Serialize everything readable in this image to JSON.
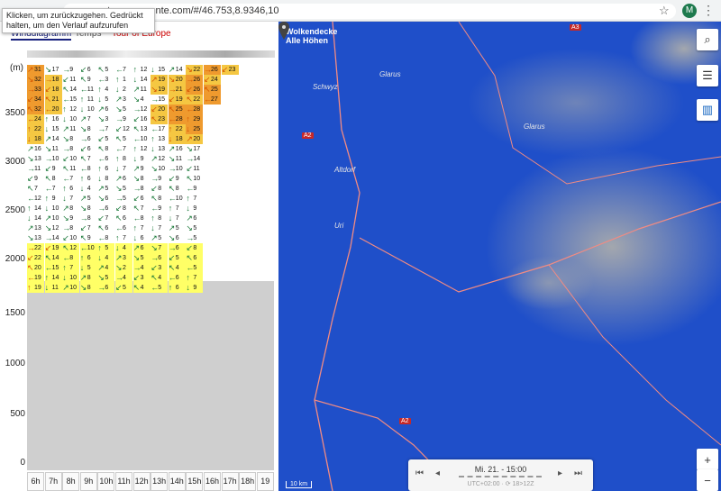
{
  "browser": {
    "url": "meteo-parapente.com/#/46.753,8.9346,10",
    "tooltip": "Klicken, um zurückzugehen. Gedrückt halten, um den Verlauf aufzurufen",
    "avatar": "M"
  },
  "tabs": [
    "Winddiagramm",
    "Temps",
    "Tour of Europe"
  ],
  "diagram": {
    "unit": "(m)",
    "y_labels": [
      "3500",
      "3000",
      "2500",
      "2000",
      "1500",
      "1000",
      "500",
      "0"
    ],
    "hours": [
      "6h",
      "7h",
      "8h",
      "9h",
      "10h",
      "11h",
      "12h",
      "13h",
      "14h",
      "15h",
      "16h",
      "17h",
      "18h",
      "19"
    ],
    "colors": {
      "calm": "#ffffff",
      "light": "#ffff66",
      "medium": "#f5c742",
      "strong": "#ef9a2e",
      "nodata": "#cfcfcf"
    },
    "rows": [
      [
        "31",
        "17",
        "9",
        "6",
        "5",
        "7",
        "12",
        "15",
        "14",
        "22",
        "26",
        "23"
      ],
      [
        "32",
        "18",
        "11",
        "9",
        "3",
        "1",
        "14",
        "19",
        "20",
        "26",
        "24"
      ],
      [
        "33",
        "18",
        "14",
        "11",
        "4",
        "2",
        "11",
        "19",
        "21",
        "26",
        "25"
      ],
      [
        "34",
        "21",
        "15",
        "11",
        "5",
        "3",
        "4",
        "15",
        "19",
        "22",
        "27"
      ],
      [
        "32",
        "20",
        "12",
        "10",
        "6",
        "5",
        "12",
        "20",
        "25",
        "28"
      ],
      [
        "24",
        "16",
        "10",
        "7",
        "3",
        "9",
        "16",
        "23",
        "28",
        "29"
      ],
      [
        "22",
        "15",
        "11",
        "8",
        "7",
        "12",
        "13",
        "17",
        "22",
        "25"
      ],
      [
        "18",
        "14",
        "8",
        "6",
        "5",
        "5",
        "10",
        "13",
        "18",
        "20"
      ],
      [
        "16",
        "11",
        "8",
        "6",
        "8",
        "7",
        "12",
        "13",
        "16",
        "17"
      ],
      [
        "13",
        "10",
        "10",
        "7",
        "6",
        "8",
        "9",
        "12",
        "11",
        "14"
      ],
      [
        "11",
        "9",
        "11",
        "8",
        "6",
        "7",
        "9",
        "10",
        "10",
        "11"
      ],
      [
        "9",
        "8",
        "7",
        "6",
        "8",
        "6",
        "8",
        "9",
        "9",
        "10"
      ],
      [
        "7",
        "7",
        "6",
        "4",
        "5",
        "5",
        "8",
        "8",
        "8",
        "9"
      ],
      [
        "12",
        "9",
        "7",
        "5",
        "6",
        "5",
        "6",
        "8",
        "10",
        "7"
      ],
      [
        "14",
        "10",
        "8",
        "8",
        "6",
        "8",
        "7",
        "9",
        "7",
        "9"
      ],
      [
        "14",
        "10",
        "9",
        "8",
        "7",
        "6",
        "8",
        "8",
        "7",
        "6"
      ],
      [
        "13",
        "12",
        "8",
        "7",
        "6",
        "6",
        "7",
        "7",
        "5",
        "5"
      ],
      [
        "13",
        "14",
        "10",
        "9",
        "8",
        "7",
        "6",
        "5",
        "6",
        "5"
      ],
      [
        "22",
        "19",
        "12",
        "10",
        "5",
        "4",
        "6",
        "7",
        "6",
        "8"
      ],
      [
        "22",
        "14",
        "8",
        "6",
        "4",
        "3",
        "5",
        "6",
        "5",
        "6"
      ],
      [
        "20",
        "15",
        "7",
        "5",
        "4",
        "2",
        "4",
        "3",
        "4",
        "5"
      ],
      [
        "19",
        "14",
        "10",
        "8",
        "5",
        "4",
        "3",
        "4",
        "6",
        "7"
      ],
      [
        "19",
        "11",
        "10",
        "8",
        "6",
        "5",
        "4",
        "5",
        "6",
        "9"
      ]
    ]
  },
  "map": {
    "title_line1": "Wolkendecke",
    "title_line2": "Alle Höhen",
    "towns": [
      "Schwyz",
      "Glarus",
      "Glarus",
      "Altdorf",
      "Uri",
      "Schwyz"
    ],
    "roads": [
      "A3",
      "A2",
      "A2"
    ],
    "scale": "10 km",
    "time_title": "Mi. 21. - 15:00",
    "time_sub": "UTC+02:00 · ⟳ 18>12Z",
    "colors": {
      "cloud": "#1f4fc9",
      "terrain": "#8a8f99"
    },
    "icons": [
      "search-icon",
      "sliders-icon",
      "chart-icon"
    ],
    "zoom_in": "+",
    "zoom_out": "−"
  }
}
